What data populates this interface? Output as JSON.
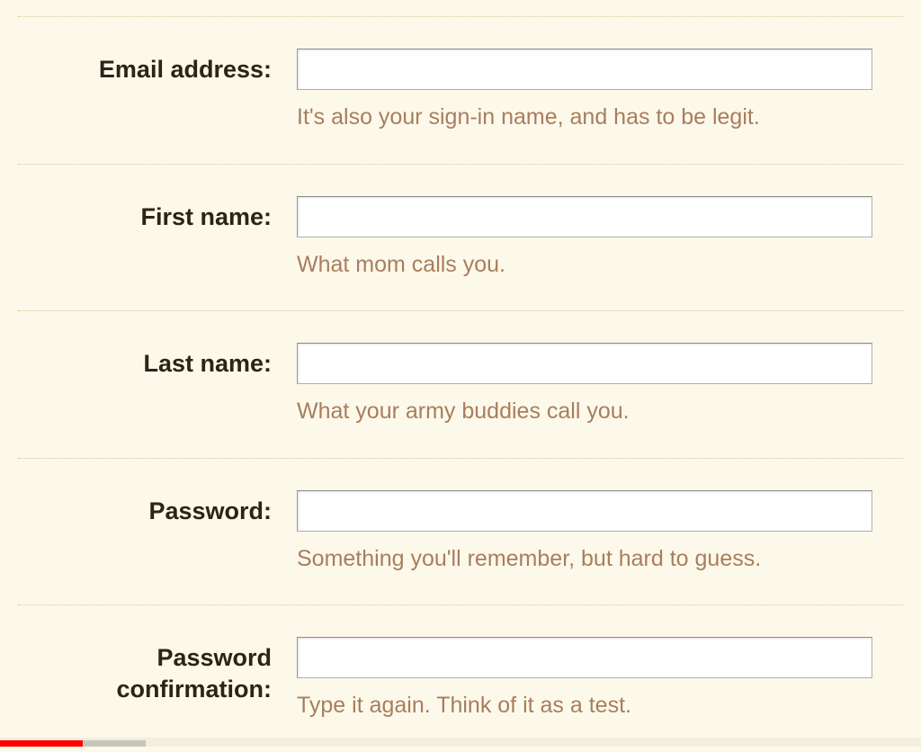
{
  "form": {
    "fields": [
      {
        "label": "Email address:",
        "helper": "It's also your sign-in name, and has to be legit.",
        "value": "",
        "type": "text"
      },
      {
        "label": "First name:",
        "helper": "What mom calls you.",
        "value": "",
        "type": "text"
      },
      {
        "label": "Last name:",
        "helper": "What your army buddies call you.",
        "value": "",
        "type": "text"
      },
      {
        "label": "Password:",
        "helper": "Something you'll remember, but hard to guess.",
        "value": "",
        "type": "password"
      },
      {
        "label": "Password confirmation:",
        "helper": "Type it again. Think of it as a test.",
        "value": "",
        "type": "password"
      }
    ]
  }
}
